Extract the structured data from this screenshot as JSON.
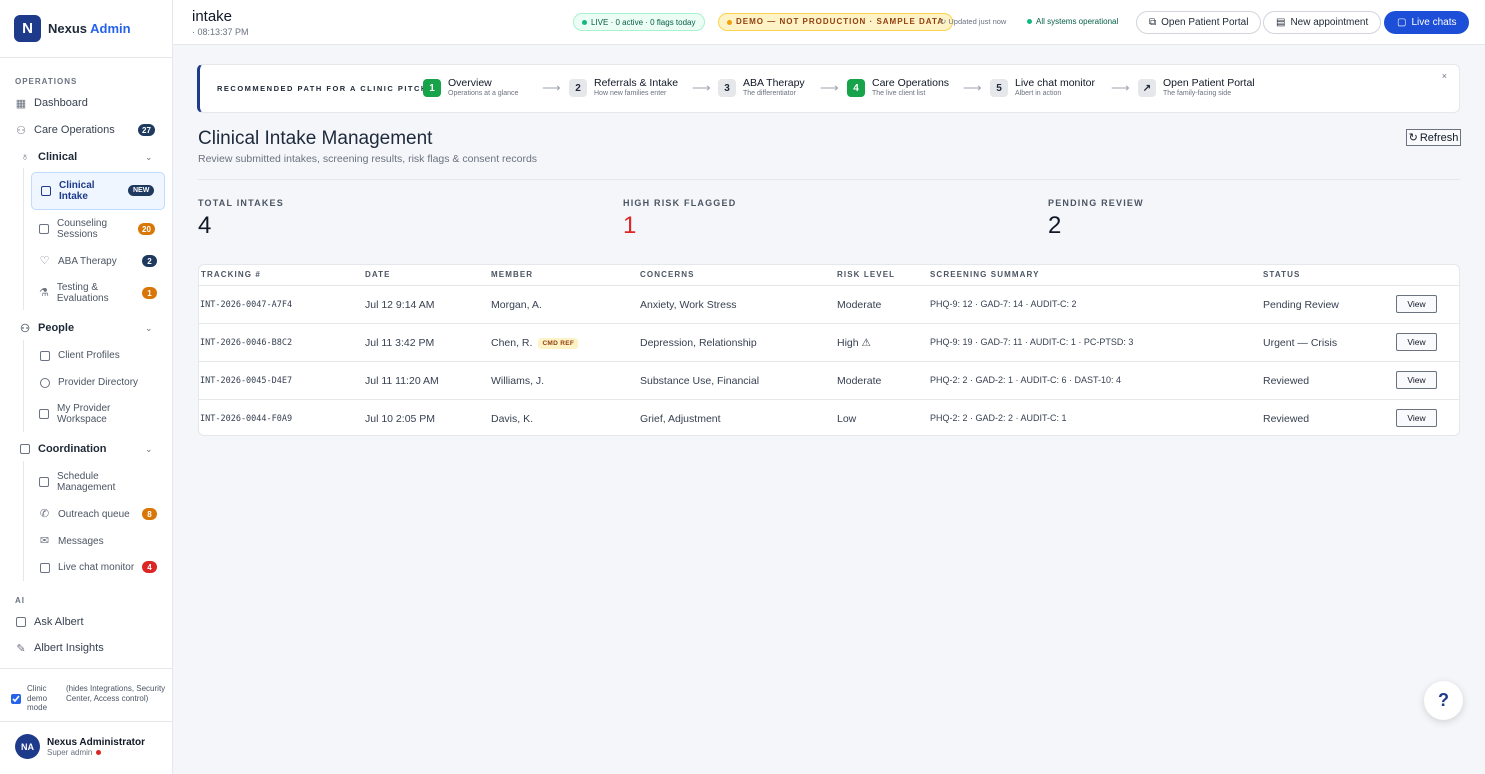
{
  "brand": {
    "logo": "N",
    "name": "Nexus",
    "name_accent": "Admin"
  },
  "sidebar": {
    "operations_label": "OPERATIONS",
    "dashboard": "Dashboard",
    "care_operations": {
      "label": "Care Operations",
      "badge": "27"
    },
    "clinical": {
      "label": "Clinical",
      "items": [
        {
          "label": "Clinical Intake",
          "badge": "NEW"
        },
        {
          "label": "Counseling Sessions",
          "badge": "20"
        },
        {
          "label": "ABA Therapy",
          "badge": "2"
        },
        {
          "label": "Testing & Evaluations",
          "badge": "1"
        }
      ]
    },
    "people": {
      "label": "People",
      "items": [
        {
          "label": "Client Profiles"
        },
        {
          "label": "Provider Directory"
        },
        {
          "label": "My Provider Workspace"
        }
      ]
    },
    "coordination": {
      "label": "Coordination",
      "items": [
        {
          "label": "Schedule Management"
        },
        {
          "label": "Outreach queue",
          "badge": "8"
        },
        {
          "label": "Messages"
        },
        {
          "label": "Live chat monitor",
          "badge": "4"
        }
      ]
    },
    "ai_label": "AI",
    "ask_albert": "Ask Albert",
    "albert_insights": "Albert Insights",
    "demo_mode": {
      "label": "Clinic demo mode",
      "note": "(hides Integrations, Security Center, Access control)",
      "checked": true
    },
    "user": {
      "initials": "NA",
      "name": "Nexus Administrator",
      "role": "Super admin"
    }
  },
  "topbar": {
    "title": "intake",
    "time": "· 08:13:37 PM",
    "live_pill": "LIVE · 0 active · 0 flags today",
    "demo_pill": "DEMO — NOT PRODUCTION · SAMPLE DATA",
    "updated": "Updated just now",
    "systems": "All systems operational",
    "btn_portal": "Open Patient Portal",
    "btn_appointment": "New appointment",
    "btn_chats": "Live chats"
  },
  "path": {
    "label": "RECOMMENDED PATH FOR A CLINIC PITCH",
    "steps": [
      {
        "num": "1",
        "title": "Overview",
        "desc": "Operations at a glance"
      },
      {
        "num": "2",
        "title": "Referrals & Intake",
        "desc": "How new families enter"
      },
      {
        "num": "3",
        "title": "ABA Therapy",
        "desc": "The differentiator"
      },
      {
        "num": "4",
        "title": "Care Operations",
        "desc": "The live client list"
      },
      {
        "num": "5",
        "title": "Live chat monitor",
        "desc": "Albert in action"
      },
      {
        "num": "↗",
        "title": "Open Patient Portal",
        "desc": "The family-facing side"
      }
    ],
    "close": "×"
  },
  "main": {
    "title": "Clinical Intake Management",
    "subtitle": "Review submitted intakes, screening results, risk flags & consent records",
    "refresh": "Refresh"
  },
  "stats": [
    {
      "label": "TOTAL INTAKES",
      "value": "4"
    },
    {
      "label": "HIGH RISK FLAGGED",
      "value": "1"
    },
    {
      "label": "PENDING REVIEW",
      "value": "2"
    }
  ],
  "table": {
    "headers": [
      "TRACKING #",
      "DATE",
      "MEMBER",
      "CONCERNS",
      "RISK LEVEL",
      "SCREENING SUMMARY",
      "STATUS"
    ],
    "rows": [
      {
        "tracking": "INT-2026-0047-A7F4",
        "date": "Jul 12 9:14 AM",
        "member": "Morgan, A.",
        "tag": "",
        "concerns": "Anxiety, Work Stress",
        "risk": "Moderate",
        "summary": "PHQ-9: 12 · GAD-7: 14 · AUDIT-C: 2",
        "status": "Pending Review",
        "action": "View"
      },
      {
        "tracking": "INT-2026-0046-B8C2",
        "date": "Jul 11 3:42 PM",
        "member": "Chen, R.",
        "tag": "CMD REF",
        "concerns": "Depression, Relationship",
        "risk": "High ⚠",
        "summary": "PHQ-9: 19 · GAD-7: 11 · AUDIT-C: 1 · PC-PTSD: 3",
        "status": "Urgent — Crisis",
        "action": "View"
      },
      {
        "tracking": "INT-2026-0045-D4E7",
        "date": "Jul 11 11:20 AM",
        "member": "Williams, J.",
        "tag": "",
        "concerns": "Substance Use, Financial",
        "risk": "Moderate",
        "summary": "PHQ-2: 2 · GAD-2: 1 · AUDIT-C: 6 · DAST-10: 4",
        "status": "Reviewed",
        "action": "View"
      },
      {
        "tracking": "INT-2026-0044-F0A9",
        "date": "Jul 10 2:05 PM",
        "member": "Davis, K.",
        "tag": "",
        "concerns": "Grief, Adjustment",
        "risk": "Low",
        "summary": "PHQ-2: 2 · GAD-2: 2 · AUDIT-C: 1",
        "status": "Reviewed",
        "action": "View"
      }
    ]
  },
  "help": "?"
}
